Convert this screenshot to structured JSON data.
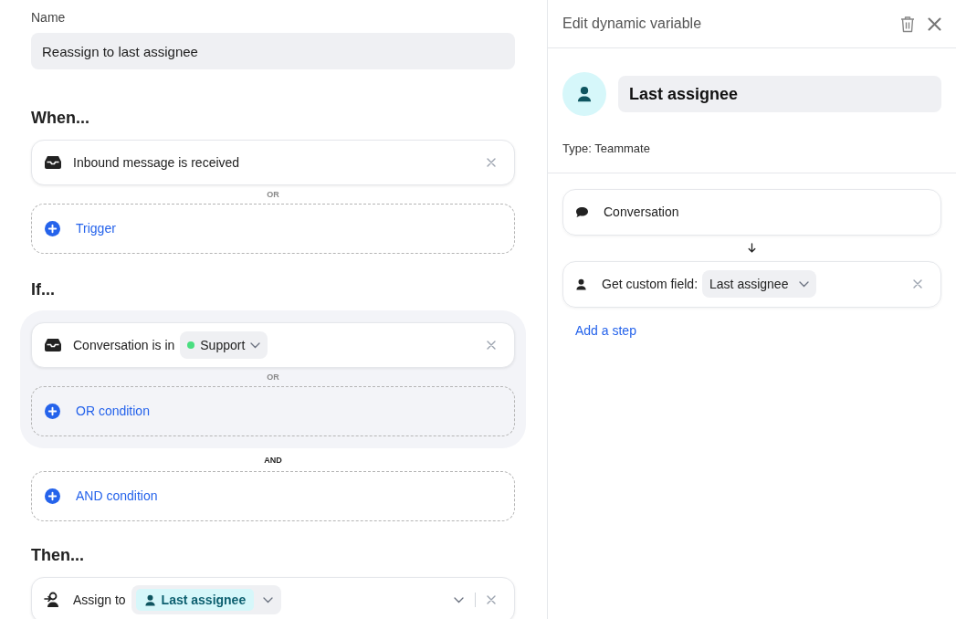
{
  "name_field": {
    "label": "Name",
    "value": "Reassign to last assignee"
  },
  "when": {
    "heading": "When...",
    "trigger": {
      "text": "Inbound message is received"
    },
    "separator": "OR",
    "add_button": "Trigger"
  },
  "if": {
    "heading": "If...",
    "condition": {
      "text": "Conversation is in",
      "chip": {
        "label": "Support",
        "color": "#4ade80"
      }
    },
    "separator": "OR",
    "or_button": "OR condition",
    "and_separator": "AND",
    "and_button": "AND condition"
  },
  "then": {
    "heading": "Then...",
    "action": {
      "text": "Assign to",
      "chip": {
        "label": "Last assignee"
      }
    }
  },
  "panel": {
    "title": "Edit dynamic variable",
    "variable_name": "Last assignee",
    "type_label": "Type: Teammate",
    "steps": [
      {
        "kind": "source",
        "text": "Conversation"
      },
      {
        "kind": "custom_field",
        "text": "Get custom field:",
        "chip": "Last assignee"
      }
    ],
    "add_step": "Add a step"
  }
}
